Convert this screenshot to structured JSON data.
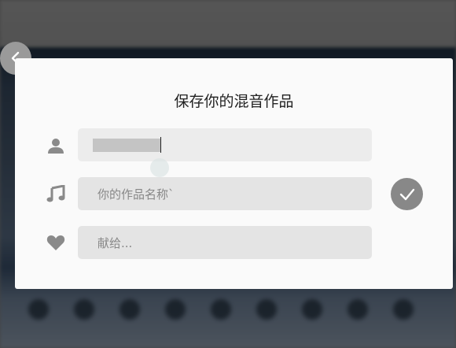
{
  "dialog": {
    "title": "保存你的混音作品",
    "fields": {
      "author": {
        "icon": "user-icon",
        "value": "",
        "redacted": true
      },
      "work_name": {
        "icon": "music-note-icon",
        "placeholder": "你的作品名称`"
      },
      "dedicate": {
        "icon": "heart-icon",
        "placeholder": "献给..."
      }
    },
    "confirm": {
      "icon": "checkmark-icon"
    }
  },
  "back": {
    "icon": "chevron-left-icon"
  },
  "colors": {
    "dialog_bg": "#fafafa",
    "field_bg": "#e4e4e4",
    "icon_gray": "#8a8a8a",
    "confirm_bg": "#888888"
  }
}
